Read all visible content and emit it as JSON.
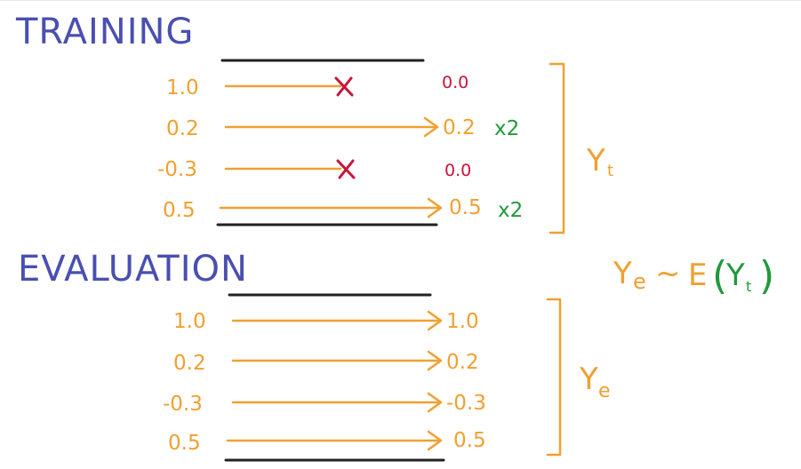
{
  "colors": {
    "title": "#4a4fb0",
    "orange": "#f0a030",
    "red": "#c8143a",
    "green": "#1e9a3a",
    "black": "#222222"
  },
  "training": {
    "title": "TRAINING",
    "rows": [
      {
        "input": "1.0",
        "output": "0.0",
        "dropped": true,
        "mult": ""
      },
      {
        "input": "0.2",
        "output": "0.2",
        "dropped": false,
        "mult": "x2"
      },
      {
        "input": "-0.3",
        "output": "0.0",
        "dropped": true,
        "mult": ""
      },
      {
        "input": "0.5",
        "output": "0.5",
        "dropped": false,
        "mult": "x2"
      }
    ],
    "bracket_label": "Y",
    "bracket_sub": "t"
  },
  "evaluation": {
    "title": "EVALUATION",
    "rows": [
      {
        "input": "1.0",
        "output": "1.0"
      },
      {
        "input": "0.2",
        "output": "0.2"
      },
      {
        "input": "-0.3",
        "output": "-0.3"
      },
      {
        "input": "0.5",
        "output": "0.5"
      }
    ],
    "bracket_label": "Y",
    "bracket_sub": "e"
  },
  "formula": {
    "lhs": "Y",
    "lhs_sub": "e",
    "tilde": "~",
    "expect": "E",
    "open": "(",
    "inner": "Y",
    "inner_sub": "t",
    "close": ")"
  },
  "icons": {
    "drop_mark": "x-mark-icon",
    "arrow": "arrow-right-icon",
    "bracket": "right-bracket-icon"
  }
}
